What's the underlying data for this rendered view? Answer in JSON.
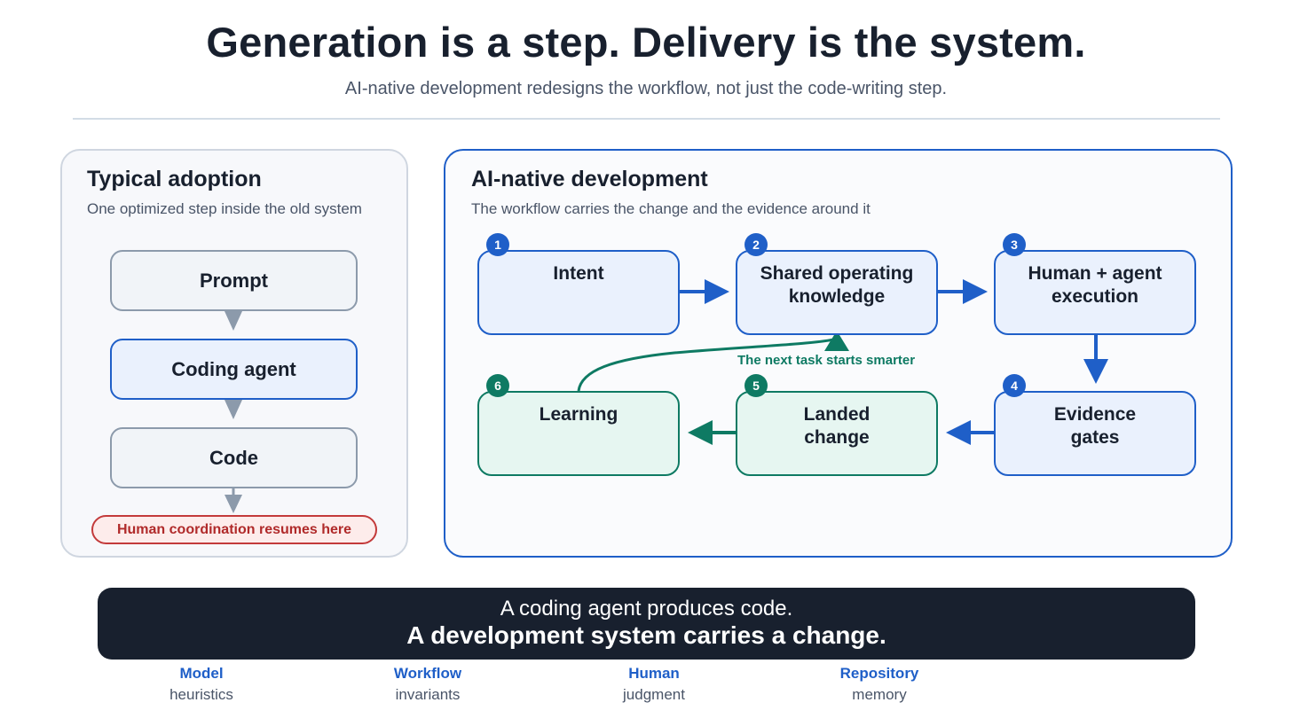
{
  "header": {
    "title": "Generation is a step. Delivery is the system.",
    "subtitle": "AI-native development redesigns the workflow, not just the code-writing step."
  },
  "left_panel": {
    "title": "Typical adoption",
    "subtitle": "One optimized step inside the old system",
    "steps": [
      "Prompt",
      "Coding agent",
      "Code"
    ],
    "callout": "Human coordination resumes here"
  },
  "right_panel": {
    "title": "AI-native development",
    "subtitle": "The workflow carries the change and the evidence around it",
    "nodes": [
      {
        "num": "1",
        "line1": "Intent",
        "line2": ""
      },
      {
        "num": "2",
        "line1": "Shared operating",
        "line2": "knowledge"
      },
      {
        "num": "3",
        "line1": "Human + agent",
        "line2": "execution"
      },
      {
        "num": "4",
        "line1": "Evidence",
        "line2": "gates"
      },
      {
        "num": "5",
        "line1": "Landed",
        "line2": "change"
      },
      {
        "num": "6",
        "line1": "Learning",
        "line2": ""
      }
    ],
    "loop_label": "The next task starts smarter"
  },
  "banner": {
    "line1": "A coding agent produces code.",
    "line2": "A development system carries a change."
  },
  "footer": [
    {
      "key": "Model",
      "value": "heuristics"
    },
    {
      "key": "Workflow",
      "value": "invariants"
    },
    {
      "key": "Human",
      "value": "judgment"
    },
    {
      "key": "Repository",
      "value": "memory"
    }
  ],
  "colors": {
    "accent_blue": "#1f5fc8",
    "accent_green": "#0e7a63",
    "warning_red": "#c33a3a",
    "dark": "#18202e"
  }
}
